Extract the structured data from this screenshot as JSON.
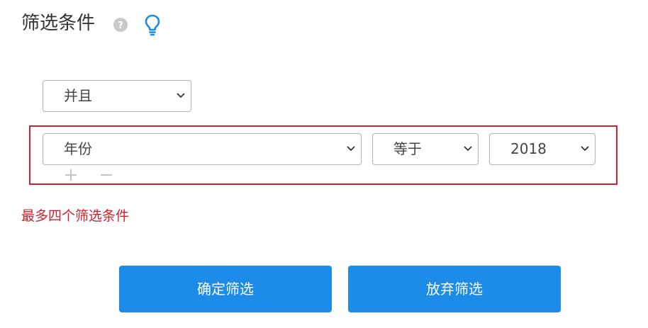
{
  "header": {
    "title": "筛选条件",
    "help_icon": "question-circle-icon",
    "hint_icon": "lightbulb-icon",
    "accent_color": "#1d8ce8"
  },
  "logic": {
    "selected": "并且"
  },
  "condition": {
    "field": "年份",
    "operator": "等于",
    "value": "2018",
    "highlight_color": "#d0202e"
  },
  "row_actions": {
    "add_icon": "plus-icon",
    "remove_icon": "minus-icon"
  },
  "warning": {
    "text": "最多四个筛选条件",
    "color": "#d0202e"
  },
  "buttons": {
    "confirm_label": "确定筛选",
    "discard_label": "放弃筛选",
    "color": "#1d8ce8"
  }
}
